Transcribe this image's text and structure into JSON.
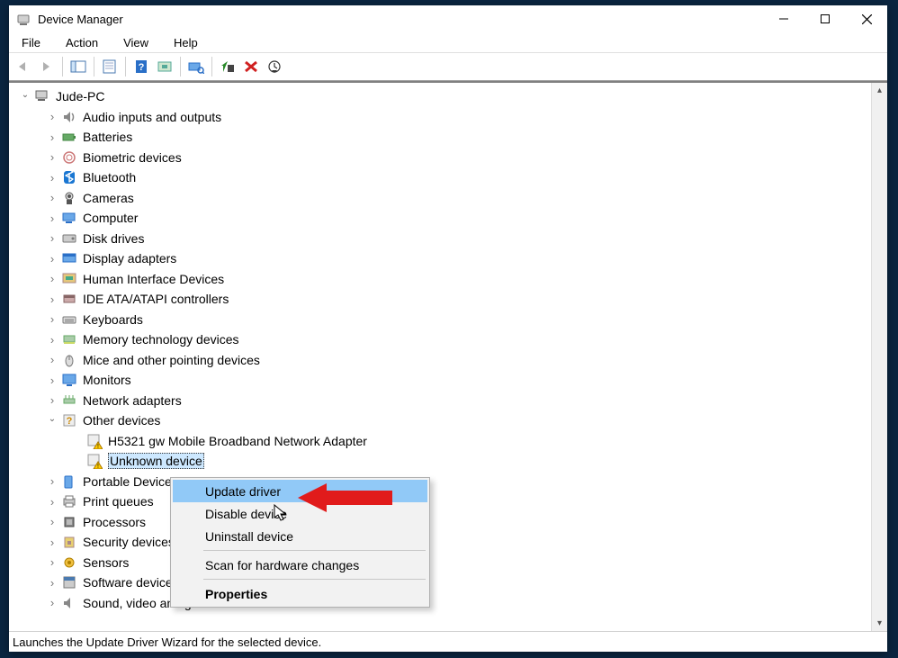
{
  "window": {
    "title": "Device Manager"
  },
  "menu": {
    "file": "File",
    "action": "Action",
    "view": "View",
    "help": "Help"
  },
  "tree": {
    "root": "Jude-PC",
    "categories": [
      "Audio inputs and outputs",
      "Batteries",
      "Biometric devices",
      "Bluetooth",
      "Cameras",
      "Computer",
      "Disk drives",
      "Display adapters",
      "Human Interface Devices",
      "IDE ATA/ATAPI controllers",
      "Keyboards",
      "Memory technology devices",
      "Mice and other pointing devices",
      "Monitors",
      "Network adapters",
      "Other devices",
      "Portable Devices",
      "Print queues",
      "Processors",
      "Security devices",
      "Sensors",
      "Software devices",
      "Sound, video and game controllers"
    ],
    "other_devices_children": [
      "H5321 gw Mobile Broadband Network Adapter",
      "Unknown device"
    ]
  },
  "context_menu": {
    "update": "Update driver",
    "disable": "Disable device",
    "uninstall": "Uninstall device",
    "scan": "Scan for hardware changes",
    "properties": "Properties"
  },
  "status": "Launches the Update Driver Wizard for the selected device."
}
